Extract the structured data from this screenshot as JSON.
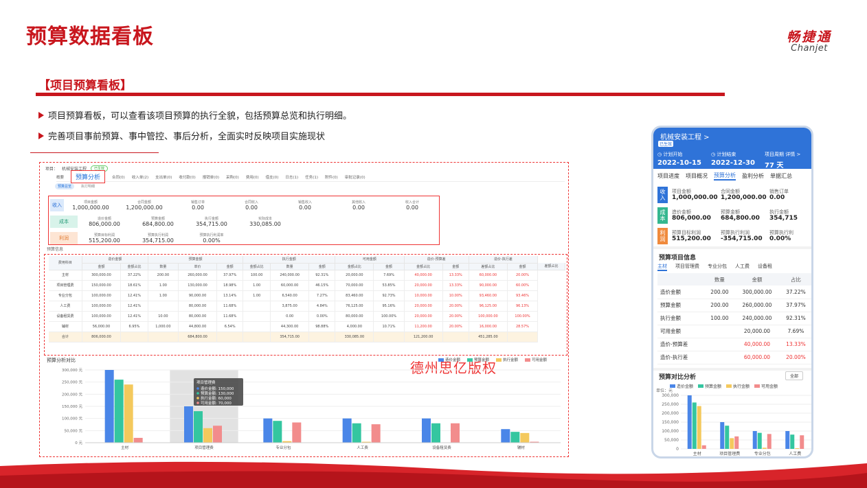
{
  "slide": {
    "title": "预算数据看板",
    "logo_zh": "畅捷通",
    "logo_en": "Chanjet",
    "section": "【项目预算看板】",
    "bullets": [
      "项目预算看板，可以查看该项目预算的执行全貌，包括预算总览和执行明细。",
      "完善项目事前预算、事中管控、事后分析，全面实时反映项目实施现状"
    ],
    "colors": {
      "brand_red": "#c8161d",
      "blue": "#4a86e8",
      "green": "#34c6a0",
      "yellow": "#f4c95d",
      "pink": "#f28c8c"
    }
  },
  "desktop": {
    "project_label": "项目：",
    "project_name": "机械安装工程",
    "status": "已生效",
    "tabs": [
      "概要",
      "预算分析",
      "合同(0)",
      "收入单(2)",
      "支出单(0)",
      "收付款(0)",
      "报销单(0)",
      "采购(0)",
      "费用(0)",
      "借支(0)",
      "日志(1)",
      "任务(1)",
      "附件(0)",
      "审批记录(0)"
    ],
    "active_tab": "预算分析",
    "subtabs": [
      "预算总览",
      "执行明细"
    ],
    "summary": {
      "income": {
        "tag": "收入",
        "items": [
          {
            "k": "项目金额",
            "v": "1,000,000.00"
          },
          {
            "k": "合同金额",
            "v": "1,200,000.00"
          },
          {
            "k": "销售订单",
            "v": "0.00"
          },
          {
            "k": "合同收入",
            "v": "0.00"
          },
          {
            "k": "销售收入",
            "v": "0.00"
          },
          {
            "k": "其他收入",
            "v": "0.00"
          },
          {
            "k": "收入合计",
            "v": "0.00"
          }
        ]
      },
      "cost": {
        "tag": "成本",
        "items": [
          {
            "k": "造价金额",
            "v": "806,000.00"
          },
          {
            "k": "预算金额",
            "v": "684,800.00"
          },
          {
            "k": "执行金额",
            "v": "354,715.00"
          },
          {
            "k": "实际成本",
            "v": "330,085.00"
          }
        ]
      },
      "profit": {
        "tag": "利润",
        "items": [
          {
            "k": "预算目标利润",
            "v": "515,200.00"
          },
          {
            "k": "预算执行利润",
            "v": "354,715.00"
          },
          {
            "k": "预算执行利润率",
            "v": "0.00%"
          }
        ]
      }
    },
    "budget_info_label": "预算信息",
    "table": {
      "group_headers": [
        "造价金额",
        "预算金额",
        "执行金额",
        "可用金额",
        "造价-预算差",
        "造价-执行差"
      ],
      "sub_headers": [
        "费用科目",
        "金额",
        "金额占比",
        "数量",
        "单价",
        "金额",
        "金额占比",
        "数量",
        "金额",
        "金额占比",
        "金额",
        "金额占比",
        "金额",
        "差额占比",
        "金额",
        "差额占比"
      ],
      "rows": [
        {
          "name": "主材",
          "c": [
            "300,000.00",
            "37.22%",
            "200.00",
            "260,000.00",
            "37.97%",
            "100.00",
            "240,000.00",
            "92.31%",
            "20,000.00",
            "7.69%",
            "40,000.00",
            "13.33%",
            "60,000.00",
            "20.00%"
          ]
        },
        {
          "name": "项目管理费",
          "c": [
            "150,000.00",
            "18.61%",
            "1.00",
            "130,000.00",
            "18.98%",
            "1.00",
            "60,000.00",
            "46.15%",
            "70,000.00",
            "53.85%",
            "20,000.00",
            "13.33%",
            "90,000.00",
            "60.00%"
          ]
        },
        {
          "name": "专业分包",
          "c": [
            "100,000.00",
            "12.41%",
            "1.00",
            "90,000.00",
            "13.14%",
            "1.00",
            "6,540.00",
            "7.27%",
            "83,460.00",
            "92.73%",
            "10,000.00",
            "10.00%",
            "93,460.00",
            "93.46%"
          ]
        },
        {
          "name": "人工费",
          "c": [
            "100,000.00",
            "12.41%",
            "",
            "80,000.00",
            "11.68%",
            "",
            "3,875.00",
            "4.84%",
            "76,125.00",
            "95.16%",
            "20,000.00",
            "20.00%",
            "96,125.00",
            "96.13%"
          ]
        },
        {
          "name": "设备租赁费",
          "c": [
            "100,000.00",
            "12.41%",
            "10.00",
            "80,000.00",
            "11.68%",
            "",
            "0.00",
            "0.00%",
            "80,000.00",
            "100.00%",
            "20,000.00",
            "20.00%",
            "100,000.00",
            "100.00%"
          ]
        },
        {
          "name": "辅材",
          "c": [
            "56,000.00",
            "6.95%",
            "1,000.00",
            "44,800.00",
            "6.54%",
            "",
            "44,300.00",
            "98.88%",
            "4,000.00",
            "10.71%",
            "11,200.00",
            "20.00%",
            "16,000.00",
            "28.57%"
          ]
        }
      ],
      "total": {
        "name": "合计",
        "c": [
          "806,000.00",
          "",
          "",
          "684,800.00",
          "",
          "",
          "354,715.00",
          "",
          "330,085.00",
          "",
          "121,200.00",
          "",
          "451,285.00",
          ""
        ]
      }
    },
    "chart_title": "预算分析对比",
    "watermark": "德州思亿版权",
    "tooltip": {
      "title": "项目管理费",
      "lines": [
        "造价金额: 150,000",
        "预算金额: 130,000",
        "执行金额: 60,000",
        "可用金额: 70,000"
      ]
    }
  },
  "chart_data": [
    {
      "type": "bar",
      "title": "预算分析对比",
      "categories": [
        "主材",
        "项目管理费",
        "专业分包",
        "人工费",
        "设备租赁费",
        "辅材"
      ],
      "series": [
        {
          "name": "造价金额",
          "values": [
            300000,
            150000,
            100000,
            100000,
            100000,
            56000
          ]
        },
        {
          "name": "预算金额",
          "values": [
            260000,
            130000,
            90000,
            80000,
            80000,
            44800
          ]
        },
        {
          "name": "执行金额",
          "values": [
            240000,
            60000,
            6540,
            3875,
            0,
            40000
          ]
        },
        {
          "name": "可用金额",
          "values": [
            20000,
            70000,
            83460,
            76125,
            80000,
            4000
          ]
        }
      ],
      "yticks": [
        "0 元",
        "50,000 元",
        "100,000 元",
        "150,000 元",
        "200,000 元",
        "250,000 元",
        "300,000 元"
      ],
      "ylim": [
        0,
        300000
      ],
      "highlight_category": "项目管理费"
    },
    {
      "type": "bar",
      "title": "预算对比分析",
      "categories": [
        "主材",
        "项目管理费",
        "专业分包",
        "人工费"
      ],
      "series": [
        {
          "name": "造价金额",
          "values": [
            300000,
            150000,
            100000,
            100000
          ]
        },
        {
          "name": "预算金额",
          "values": [
            260000,
            130000,
            90000,
            80000
          ]
        },
        {
          "name": "执行金额",
          "values": [
            240000,
            60000,
            6540,
            3875
          ]
        },
        {
          "name": "可用金额",
          "values": [
            20000,
            70000,
            83460,
            76125
          ]
        }
      ],
      "yticks": [
        "0",
        "50,000",
        "100,000",
        "150,000",
        "200,000",
        "250,000",
        "300,000"
      ],
      "ylim": [
        0,
        300000
      ],
      "ylabel": "单位：元"
    }
  ],
  "phone": {
    "name": "机械安装工程 >",
    "badge": "已生效",
    "plan_start_label": "计划开始",
    "plan_start": "2022-10-15",
    "plan_end_label": "计划结束",
    "plan_end": "2022-12-30",
    "period_label": "项目周期",
    "period": "77 天",
    "detail": "详情 >",
    "tabs": [
      "项目进度",
      "项目概况",
      "预算分析",
      "盈利分析",
      "单据汇总"
    ],
    "active_tab": "预算分析",
    "income": {
      "tag": "收入",
      "items": [
        {
          "k": "项目金额",
          "v": "1,000,000.00"
        },
        {
          "k": "合同金额",
          "v": "1,200,000.00"
        },
        {
          "k": "销售订单",
          "v": "0.00"
        }
      ]
    },
    "cost": {
      "tag": "成本",
      "items": [
        {
          "k": "造价金额",
          "v": "806,000.00"
        },
        {
          "k": "预算金额",
          "v": "684,800.00"
        },
        {
          "k": "执行金额",
          "v": "354,715"
        }
      ]
    },
    "profit": {
      "tag": "利润",
      "items": [
        {
          "k": "预算目标利润",
          "v": "515,200.00"
        },
        {
          "k": "预算执行利润",
          "v": "-354,715.00"
        },
        {
          "k": "预算执行利",
          "v": "0.00%"
        }
      ]
    },
    "info_title": "预算项目信息",
    "info_tabs": [
      "主材",
      "项目管理费",
      "专业分包",
      "人工费",
      "设备租"
    ],
    "table_headers": [
      "",
      "数量",
      "金额",
      "占比"
    ],
    "table_rows": [
      {
        "k": "造价金额",
        "q": "200.00",
        "a": "300,000.00",
        "p": "37.22%",
        "red": false
      },
      {
        "k": "预算金额",
        "q": "200.00",
        "a": "260,000.00",
        "p": "37.97%",
        "red": false
      },
      {
        "k": "执行金额",
        "q": "100.00",
        "a": "240,000.00",
        "p": "92.31%",
        "red": false
      },
      {
        "k": "可用金额",
        "q": "",
        "a": "20,000.00",
        "p": "7.69%",
        "red": false
      },
      {
        "k": "造价-预算差",
        "q": "",
        "a": "40,000.00",
        "p": "13.33%",
        "red": true
      },
      {
        "k": "造价-执行差",
        "q": "",
        "a": "60,000.00",
        "p": "20.00%",
        "red": true
      }
    ],
    "chart_title": "预算对比分析",
    "chart_all": "全部",
    "legend": [
      "造价金额",
      "预算金额",
      "执行金额",
      "可用金额"
    ]
  }
}
